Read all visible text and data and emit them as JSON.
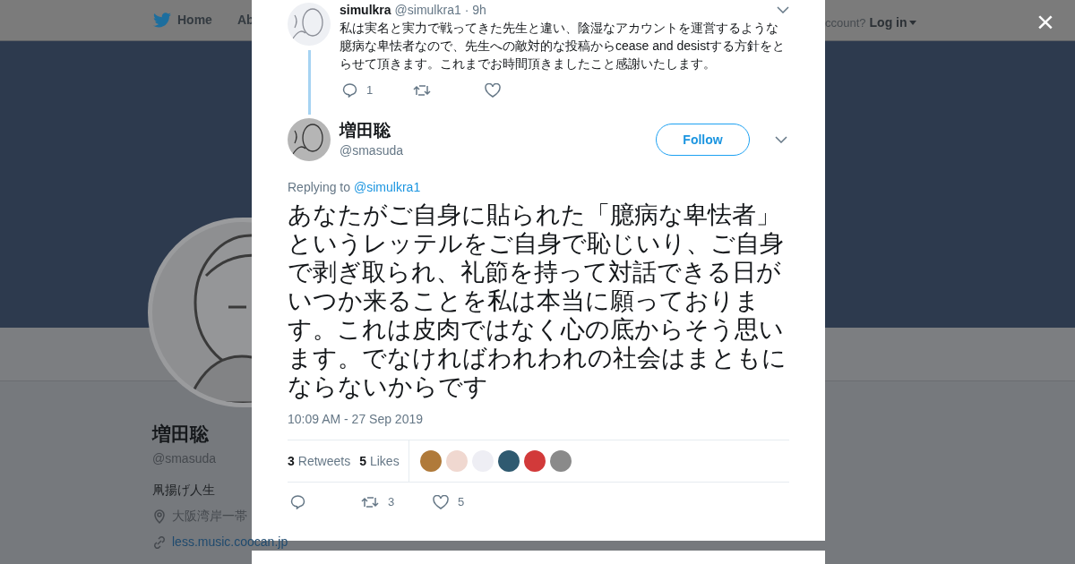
{
  "background_page": {
    "nav": [
      {
        "label": "Home",
        "kind": "home"
      },
      {
        "label": "Ab",
        "kind": "plain"
      }
    ],
    "account_prompt": "ccount?",
    "login": "Log in",
    "profile": {
      "name": "増田聡",
      "handle": "@smasuda",
      "bio": "凧揚げ人生",
      "location": "大阪湾岸一帯",
      "link": "less.music.coocan.jp"
    }
  },
  "close": "×",
  "parent_tweet": {
    "name": "simulkra",
    "handle": "@simulkra1",
    "time": "· 9h",
    "text": "私は実名と実力で戦ってきた先生と違い、陰湿なアカウントを運営するような臆病な卑怯者なので、先生への敵対的な投稿からcease and desistする方針をとらせて頂きます。これまでお時間頂きましたこと感謝いたします。",
    "replies": "1"
  },
  "tweet": {
    "name": "増田聡",
    "handle": "@smasuda",
    "follow": "Follow",
    "replying_to": "Replying to",
    "replying_handle": "@simulkra1",
    "text": "あなたがご自身に貼られた「臆病な卑怯者」というレッテルをご自身で恥じいり、ご自身で剥ぎ取られ、礼節を持って対話できる日がいつか来ることを私は本当に願っております。これは皮肉ではなく心の底からそう思います。でなければわれわれの社会はまともにならないからです",
    "timestamp": "10:09 AM - 27 Sep 2019",
    "retweets_count": "3",
    "retweets_label": "Retweets",
    "likes_count": "5",
    "likes_label": "Likes",
    "likers": [
      {
        "color": "#b07a3a"
      },
      {
        "color": "#f0d8d0"
      },
      {
        "color": "#eeeef4"
      },
      {
        "color": "#2f5a70"
      },
      {
        "color": "#d23a3a"
      },
      {
        "color": "#8a8a8a"
      }
    ],
    "action_retweets": "3",
    "action_likes": "5"
  }
}
